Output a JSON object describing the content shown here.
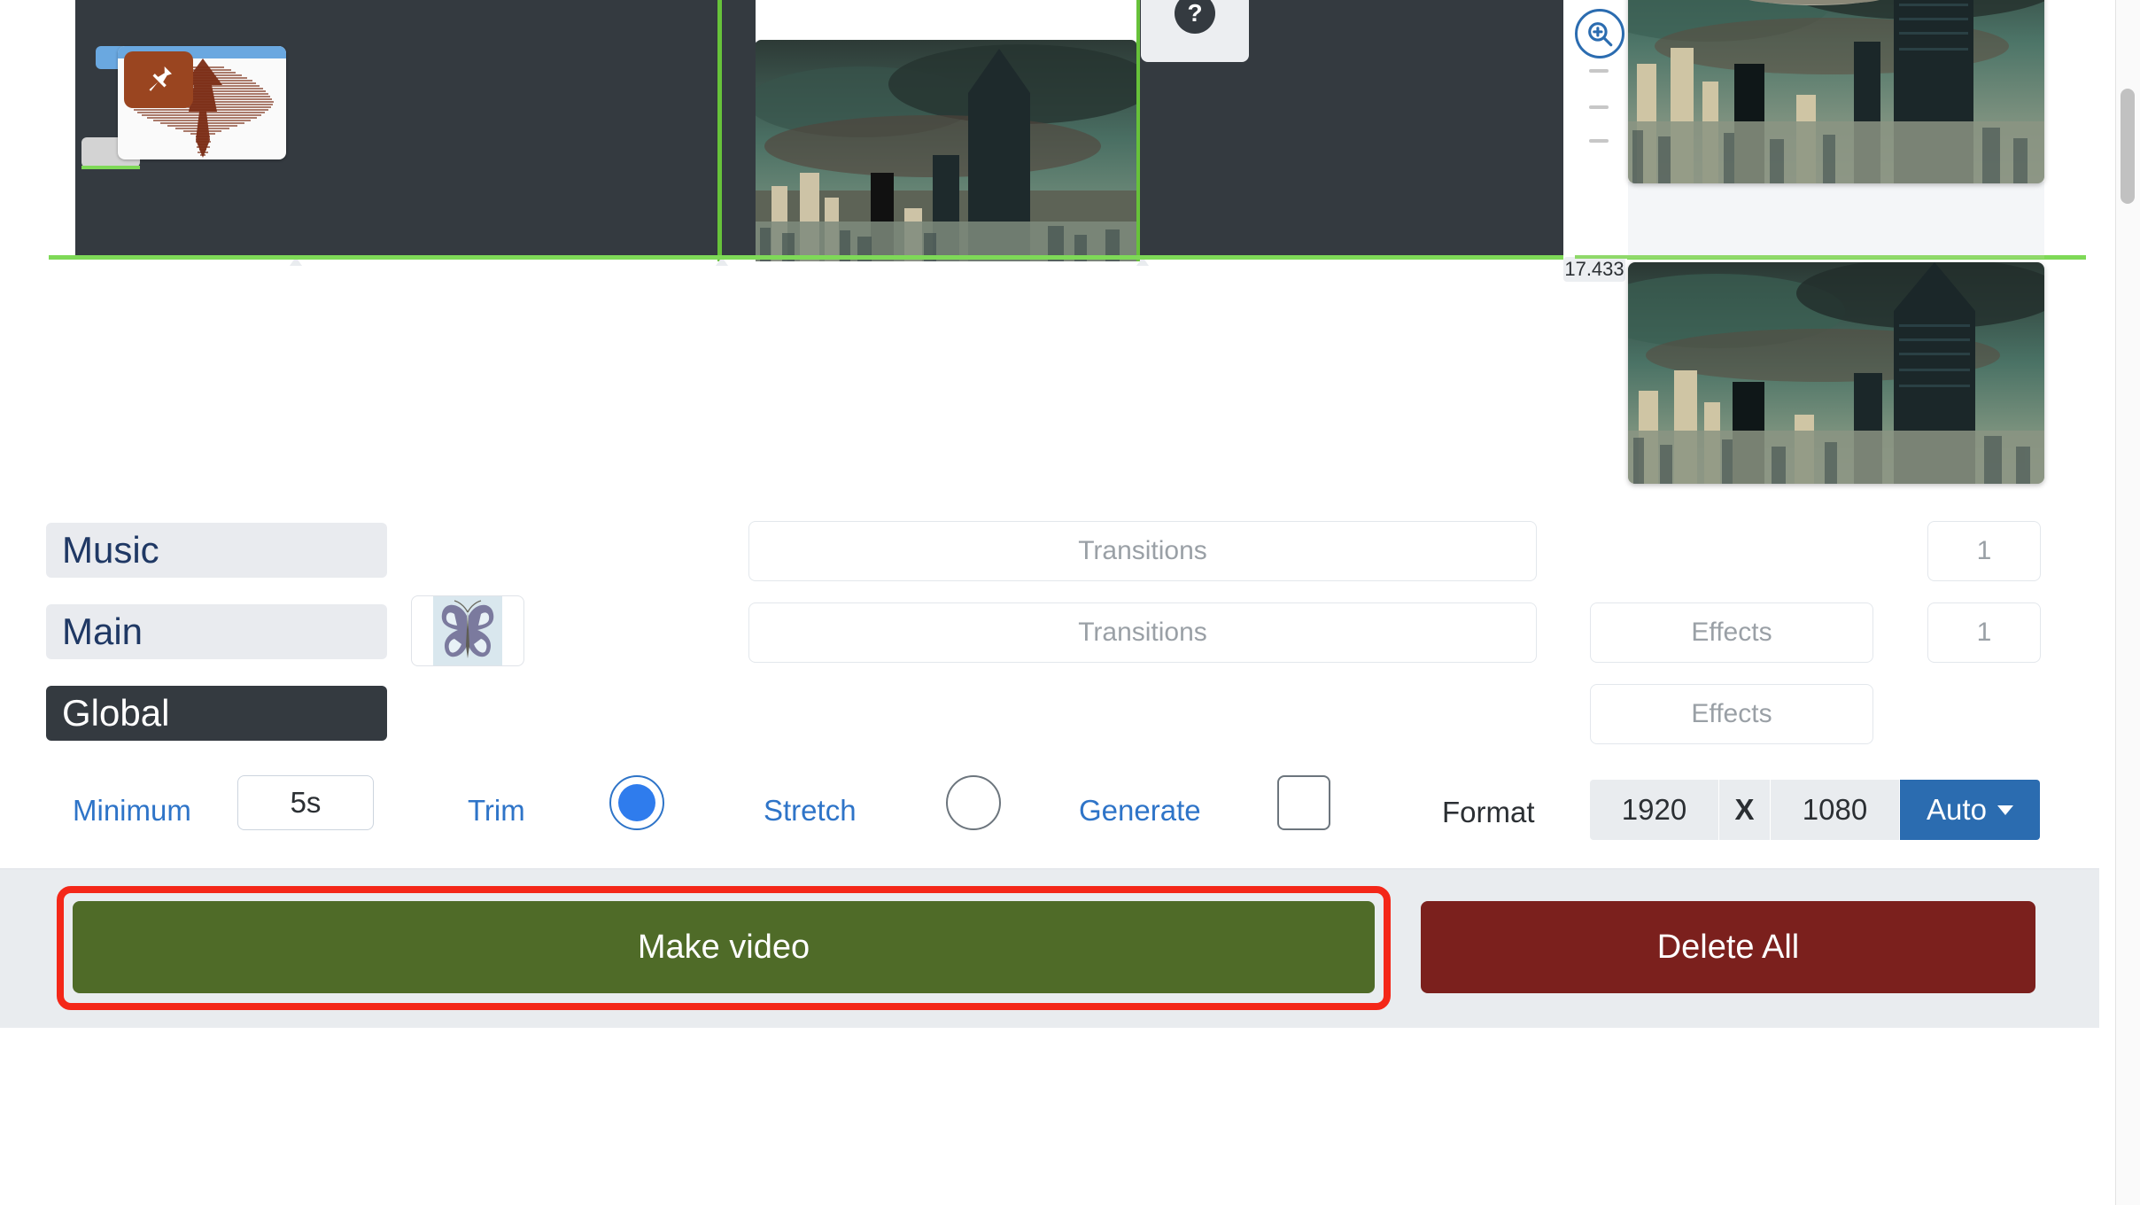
{
  "timeline": {
    "timecode": "17.433",
    "zoom_icon": "zoom-in-icon",
    "help_label": "?",
    "audio_clip": {
      "icon": "pin-icon",
      "kind": "audio-waveform-clip"
    },
    "video_clip": {
      "kind": "video-thumbnail-clip"
    }
  },
  "preview": {
    "frame_top_alt": "city skyline with hovering spaceship",
    "frame_bottom_alt": "city skyline with storm clouds"
  },
  "tracks": [
    {
      "name": "Music",
      "selected": false
    },
    {
      "name": "Main",
      "selected": false
    },
    {
      "name": "Global",
      "selected": true
    }
  ],
  "thumbnail": {
    "alt": "butterfly"
  },
  "transitions": [
    {
      "placeholder": "Transitions",
      "count": "1"
    },
    {
      "placeholder": "Transitions",
      "count": "1"
    }
  ],
  "effects": [
    {
      "placeholder": "Effects",
      "count": "1"
    },
    {
      "placeholder": "Effects",
      "count": ""
    }
  ],
  "options": {
    "minimum_label": "Minimum",
    "minimum_value": "5s",
    "trim_label": "Trim",
    "trim_selected": true,
    "stretch_label": "Stretch",
    "stretch_selected": false,
    "generate_label": "Generate",
    "generate_checked": false
  },
  "format": {
    "label": "Format",
    "width": "1920",
    "separator": "X",
    "height": "1080",
    "mode": "Auto"
  },
  "actions": {
    "make_video": "Make video",
    "delete_all": "Delete All"
  },
  "colors": {
    "accent_blue": "#2e74c8",
    "make_green": "#4f6b28",
    "delete_red": "#7b201d",
    "highlight_red": "#f42718",
    "track_dark": "#343a40",
    "playhead_green": "#7ed957"
  }
}
